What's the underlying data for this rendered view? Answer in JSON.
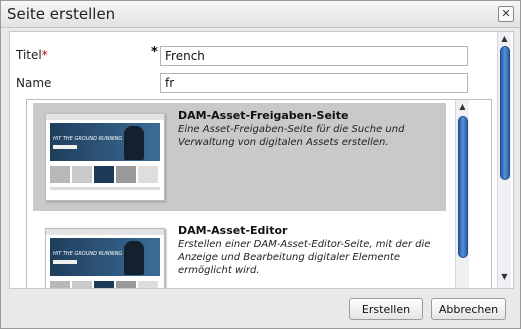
{
  "dialog": {
    "title": "Seite erstellen",
    "close_icon": "close-icon"
  },
  "form": {
    "title_label": "Titel",
    "title_required_marker": "*",
    "required_marker": "*",
    "title_value": "French",
    "name_label": "Name",
    "name_value": "fr"
  },
  "templates": [
    {
      "name": "DAM-Asset-Freigaben-Seite",
      "description": "Eine Asset-Freigaben-Seite für die Suche und Verwaltung von digitalen Assets erstellen.",
      "selected": true,
      "thumbnail_text": "HIT THE GROUND RUNNING"
    },
    {
      "name": "DAM-Asset-Editor",
      "description": "Erstellen einer DAM-Asset-Editor-Seite, mit der die Anzeige und Bearbeitung digitaler Elemente ermöglicht wird.",
      "selected": false,
      "thumbnail_text": "HIT THE GROUND RUNNING"
    }
  ],
  "buttons": {
    "create_label": "Erstellen",
    "cancel_label": "Abbrechen"
  },
  "icons": {
    "scroll_up": "▲",
    "scroll_down": "▼"
  }
}
